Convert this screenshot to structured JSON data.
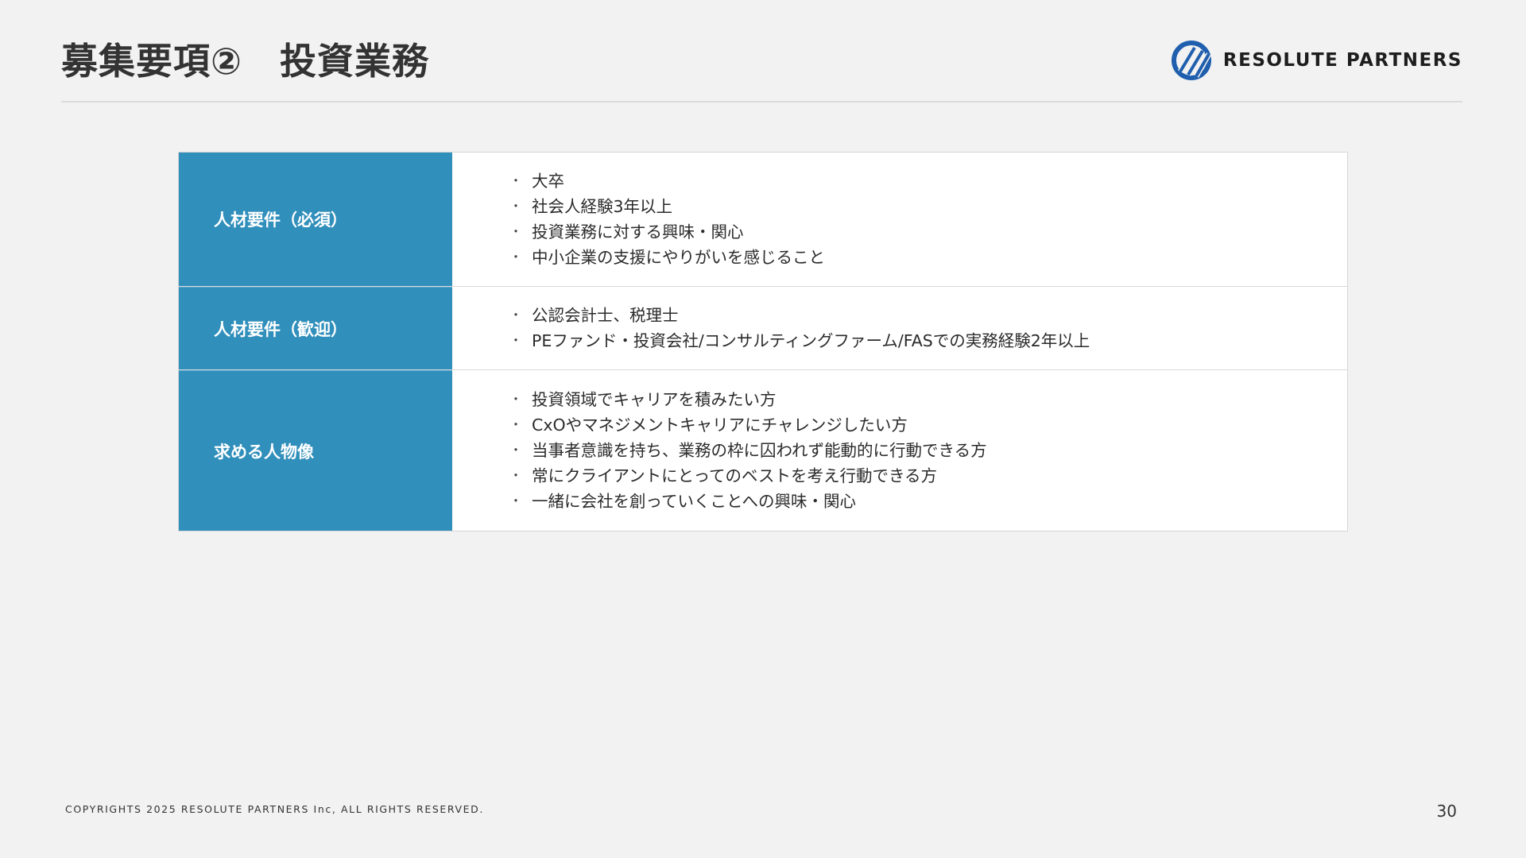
{
  "header": {
    "title": "募集要項②　投資業務",
    "logo_text": "RESOLUTE PARTNERS"
  },
  "table": {
    "rows": [
      {
        "label": "人材要件（必須）",
        "items": [
          "大卒",
          "社会人経験3年以上",
          "投資業務に対する興味・関心",
          "中小企業の支援にやりがいを感じること"
        ]
      },
      {
        "label": "人材要件（歓迎）",
        "items": [
          "公認会計士、税理士",
          "PEファンド・投資会社/コンサルティングファーム/FASでの実務経験2年以上"
        ]
      },
      {
        "label": "求める人物像",
        "items": [
          "投資領域でキャリアを積みたい方",
          "CxOやマネジメントキャリアにチャレンジしたい方",
          "当事者意識を持ち、業務の枠に囚われず能動的に行動できる方",
          "常にクライアントにとってのベストを考え行動できる方",
          "一緒に会社を創っていくことへの興味・関心"
        ]
      }
    ]
  },
  "footer": {
    "copyright": "COPYRIGHTS 2025 RESOLUTE PARTNERS Inc, ALL RIGHTS RESERVED.",
    "page_number": "30"
  },
  "colors": {
    "label_background": "#318fbb",
    "logo_blue": "#1f5fae",
    "page_background": "#f2f2f2"
  },
  "icons": {
    "logo": "resolute-partners-logo-icon"
  }
}
